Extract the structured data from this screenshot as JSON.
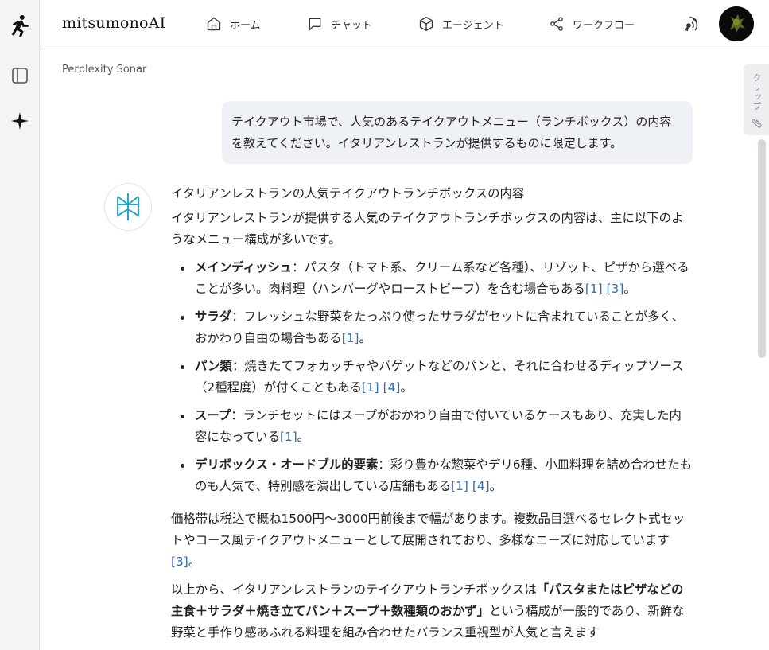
{
  "app": {
    "brand": "mitsumonoAI",
    "model_label": "Perplexity Sonar",
    "clip_label": "クリップ"
  },
  "nav": {
    "items": [
      {
        "label": "ホーム",
        "icon": "home-icon"
      },
      {
        "label": "チャット",
        "icon": "chat-icon"
      },
      {
        "label": "エージェント",
        "icon": "cube-icon"
      },
      {
        "label": "ワークフロー",
        "icon": "share-icon"
      }
    ]
  },
  "chat": {
    "user_message": "テイクアウト市場で、人気のあるテイクアウトメニュー（ランチボックス）の内容を教えてください。イタリアンレストランが提供するものに限定します。",
    "answer": {
      "heading": "イタリアンレストランの人気テイクアウトランチボックスの内容",
      "intro": "イタリアンレストランが提供する人気のテイクアウトランチボックスの内容は、主に以下のようなメニュー構成が多いです。",
      "items": [
        {
          "term": "メインディッシュ",
          "text": "：パスタ（トマト系、クリーム系など各種）、リゾット、ピザから選べることが多い。肉料理（ハンバーグやローストビーフ）を含む場合もある",
          "cites": [
            "[1]",
            "[3]"
          ],
          "end": "。"
        },
        {
          "term": "サラダ",
          "text": "：フレッシュな野菜をたっぷり使ったサラダがセットに含まれていることが多く、おかわり自由の場合もある",
          "cites": [
            "[1]"
          ],
          "end": "。"
        },
        {
          "term": "パン類",
          "text": "：焼きたてフォカッチャやバゲットなどのパンと、それに合わせるディップソース（2種程度）が付くこともある",
          "cites": [
            "[1]",
            "[4]"
          ],
          "end": "。"
        },
        {
          "term": "スープ",
          "text": "：ランチセットにはスープがおかわり自由で付いているケースもあり、充実した内容になっている",
          "cites": [
            "[1]"
          ],
          "end": "。"
        },
        {
          "term": "デリボックス・オードブル的要素",
          "text": "：彩り豊かな惣菜やデリ6種、小皿料理を詰め合わせたものも人気で、特別感を演出している店舗もある",
          "cites": [
            "[1]",
            "[4]"
          ],
          "end": "。"
        }
      ],
      "price_text": "価格帯は税込で概ね1500円〜3000円前後まで幅があります。複数品目選べるセレクト式セットやコース風テイクアウトメニューとして展開されており、多様なニーズに対応しています",
      "price_cite": "[3]",
      "price_end": "。",
      "conclusion_pre": "以上から、イタリアンレストランのテイクアウトランチボックスは",
      "conclusion_bold": "「パスタまたはピザなどの主食＋サラダ＋焼き立てパン＋スープ＋数種類のおかず」",
      "conclusion_post": "という構成が一般的であり、新鮮な野菜と手作り感あふれる料理を組み合わせたバランス重視型が人気と言えます"
    }
  }
}
